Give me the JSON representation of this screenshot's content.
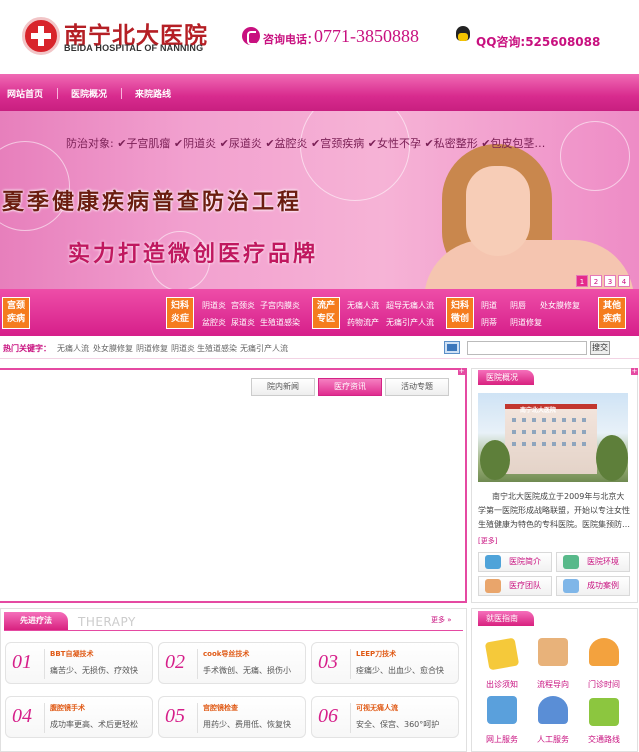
{
  "header": {
    "logo_cn": "南宁北大医院",
    "logo_en": "BEIDA HOSPITAL OF NANNING",
    "phone_label": "咨询电话：",
    "phone_number": "0771-3850888",
    "qq_text": "QQ咨询:525608088"
  },
  "nav": {
    "items": [
      {
        "label": "网站首页"
      },
      {
        "label": "医院概况"
      },
      {
        "label": "来院路线"
      }
    ]
  },
  "banner": {
    "line1": "防治对象: ✔子宫肌瘤 ✔阴道炎 ✔尿道炎 ✔盆腔炎 ✔宫颈疾病 ✔女性不孕 ✔私密整形 ✔包皮包茎…",
    "title": "夏季健康疾病普查防治工程",
    "subtitle": "实力打造微创医疗品牌",
    "pager": [
      "1",
      "2",
      "3",
      "4"
    ]
  },
  "categories": {
    "boxes": [
      {
        "label": "宫颈疾病"
      },
      {
        "label": "妇科炎症"
      },
      {
        "label": "流产专区"
      },
      {
        "label": "妇科微创"
      },
      {
        "label": "其他疾病"
      }
    ],
    "links_inflammation": [
      "阴道炎",
      "宫颈炎",
      "子宫内膜炎",
      "盆腔炎",
      "尿道炎",
      "生殖道感染"
    ],
    "links_abortion": [
      "无痛人流",
      "超导无痛人流",
      "药物流产",
      "无痛引产人流"
    ],
    "links_minimal": [
      "阴道",
      "阴唇",
      "处女膜修复",
      "阴蒂",
      "阴道修复"
    ]
  },
  "hot": {
    "label": "热门关键字：",
    "words": [
      "无痛人流",
      "处女膜修复",
      "阴道修复",
      "阴道炎",
      "生殖道感染",
      "无痛引产人流"
    ],
    "search_button": "搜交"
  },
  "news": {
    "tabs": [
      {
        "label": "院内新闻"
      },
      {
        "label": "医疗资讯"
      },
      {
        "label": "活动专题"
      }
    ]
  },
  "overview": {
    "title": "医院概况",
    "photo_sign": "南宁北大医院",
    "intro": "南宁北大医院成立于2009年与北京大学第一医院形成战略联盟，开始以专注女性生殖健康为特色的专科医院。医院集预防…",
    "more": "[更多]",
    "buttons": [
      {
        "label": "医院简介"
      },
      {
        "label": "医院环境"
      },
      {
        "label": "医疗团队"
      },
      {
        "label": "成功案例"
      }
    ]
  },
  "therapy": {
    "title": "先进疗法",
    "title_en": "THERAPY",
    "more": "更多 »",
    "cards": [
      {
        "num": "01",
        "title": "BBT自凝技术",
        "desc": "痛苦少、无损伤、疗效快"
      },
      {
        "num": "02",
        "title": "cook导丝技术",
        "desc": "手术微创、无痛、损伤小"
      },
      {
        "num": "03",
        "title": "LEEP刀技术",
        "desc": "痊痛少、出血少、愈合快"
      },
      {
        "num": "04",
        "title": "腹腔镜手术",
        "desc": "成功率更高、术后更轻松"
      },
      {
        "num": "05",
        "title": "宫腔镜检查",
        "desc": "用药少、费用低、恢复快"
      },
      {
        "num": "06",
        "title": "可视无痛人流",
        "desc": "安全、保宫、360°呵护"
      }
    ]
  },
  "guide": {
    "title": "就医指南",
    "items": [
      {
        "label": "出诊须知"
      },
      {
        "label": "流程导向"
      },
      {
        "label": "门诊时间"
      },
      {
        "label": "网上服务"
      },
      {
        "label": "人工服务"
      },
      {
        "label": "交通路线"
      }
    ]
  },
  "colors": {
    "brand": "#c8107f",
    "accent": "#e54aa2",
    "orange": "#f57c1e"
  }
}
